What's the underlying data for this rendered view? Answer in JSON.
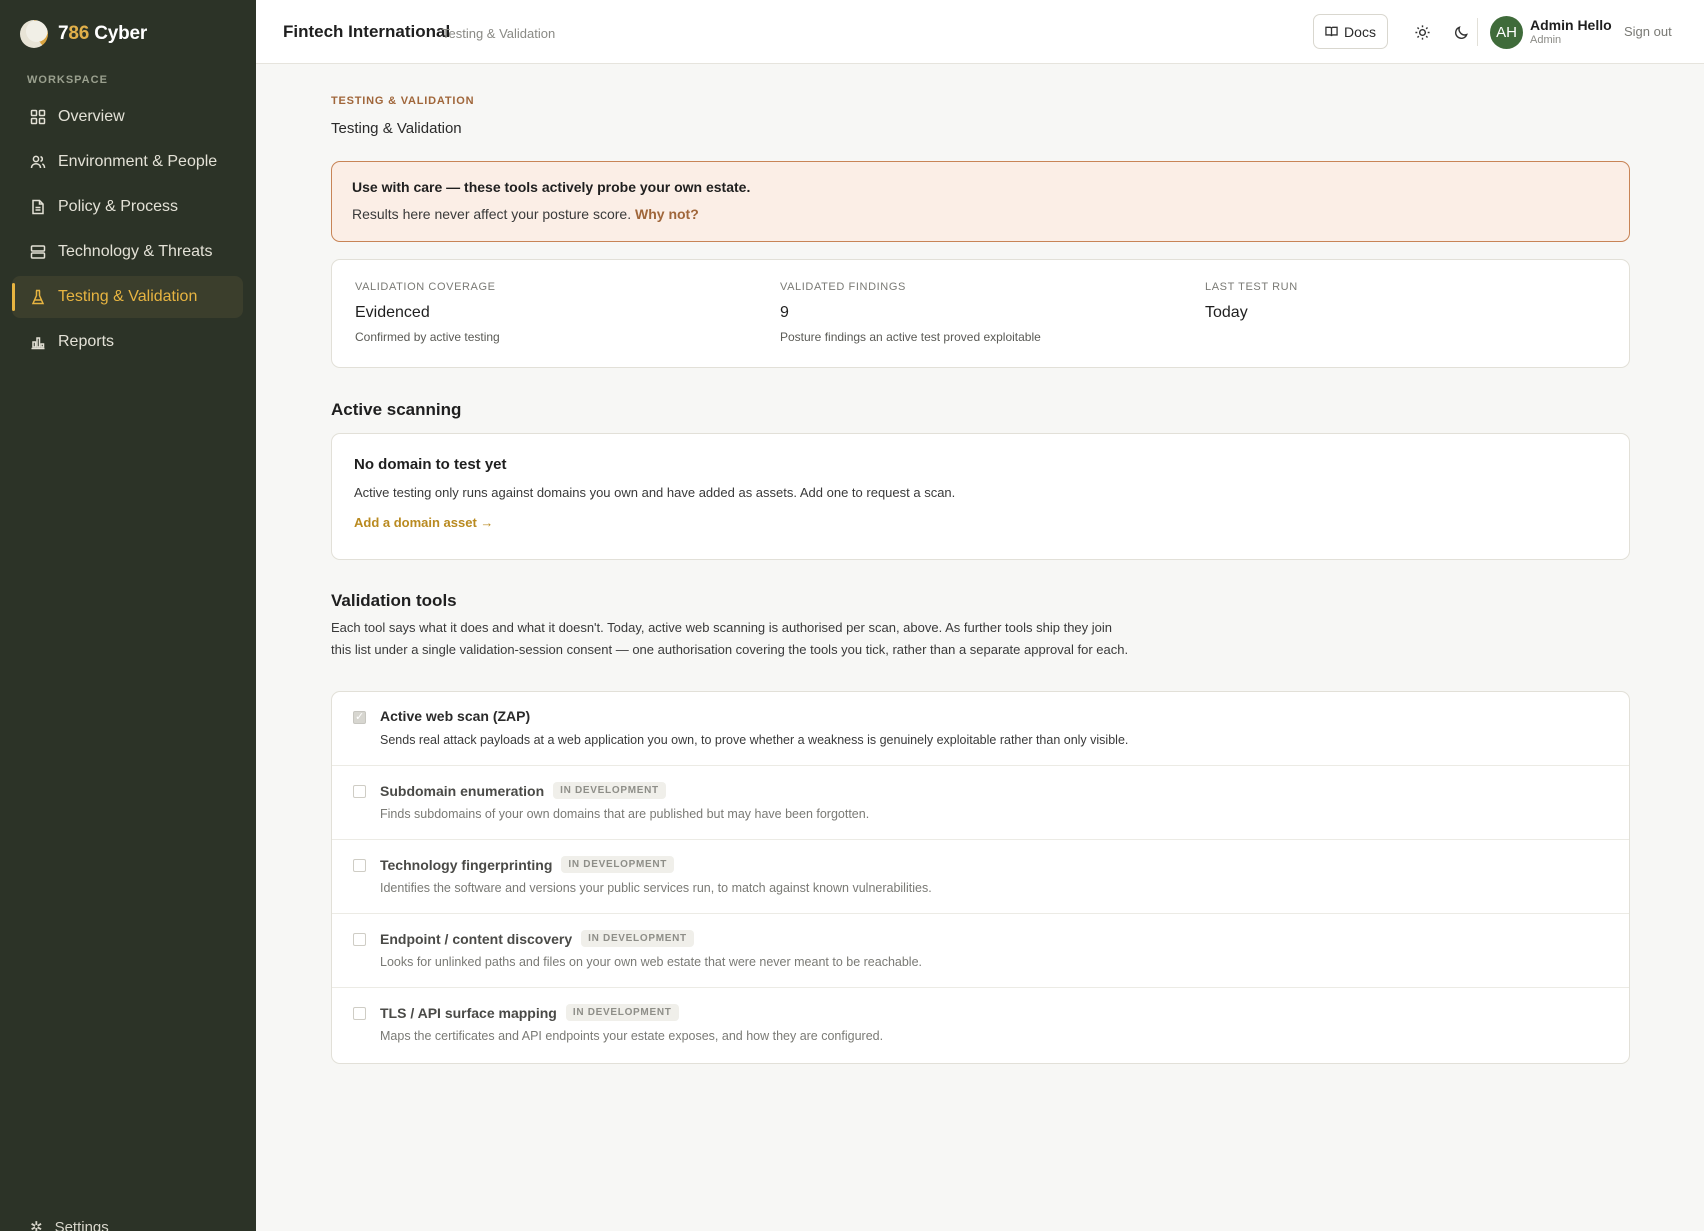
{
  "brand": {
    "name_prefix": "7",
    "name_accent": "86",
    "name_suffix": " Cyber"
  },
  "sidebar": {
    "section_label": "WORKSPACE",
    "items": [
      {
        "label": "Overview",
        "icon": "grid-icon",
        "active": false
      },
      {
        "label": "Environment & People",
        "icon": "users-icon",
        "active": false
      },
      {
        "label": "Policy & Process",
        "icon": "document-icon",
        "active": false
      },
      {
        "label": "Technology & Threats",
        "icon": "server-icon",
        "active": false
      },
      {
        "label": "Testing & Validation",
        "icon": "flask-icon",
        "active": true
      },
      {
        "label": "Reports",
        "icon": "bar-chart-icon",
        "active": false
      }
    ],
    "settings_label": "Settings"
  },
  "topbar": {
    "org_name": "Fintech International",
    "breadcrumb": "Testing & Validation",
    "docs_label": "Docs",
    "user_initials": "AH",
    "user_name": "Admin Hello",
    "user_role": "Admin",
    "signout_label": "Sign out"
  },
  "page": {
    "eyebrow": "TESTING & VALIDATION",
    "title": "Testing & Validation",
    "warning": {
      "title": "Use with care — these tools actively probe your own estate.",
      "body": "Results here never affect your posture score. ",
      "link": "Why not?"
    },
    "stats": [
      {
        "label": "VALIDATION COVERAGE",
        "value": "Evidenced",
        "note": "Confirmed by active testing"
      },
      {
        "label": "VALIDATED FINDINGS",
        "value": "9",
        "note": "Posture findings an active test proved exploitable"
      },
      {
        "label": "LAST TEST RUN",
        "value": "Today",
        "note": ""
      }
    ],
    "active_scanning": {
      "heading": "Active scanning",
      "card_title": "No domain to test yet",
      "card_body": "Active testing only runs against domains you own and have added as assets. Add one to request a scan.",
      "card_link": "Add a domain asset →"
    },
    "validation_tools": {
      "heading": "Validation tools",
      "intro": "Each tool says what it does and what it doesn't. Today, active web scanning is authorised per scan, above. As further tools ship they join this list under a single validation-session consent — one authorisation covering the tools you tick, rather than a separate approval for each.",
      "tools": [
        {
          "name": "Active web scan (ZAP)",
          "badge": "",
          "checked": true,
          "desc": "Sends real attack payloads at a web application you own, to prove whether a weakness is genuinely exploitable rather than only visible."
        },
        {
          "name": "Subdomain enumeration",
          "badge": "IN DEVELOPMENT",
          "checked": false,
          "desc": "Finds subdomains of your own domains that are published but may have been forgotten."
        },
        {
          "name": "Technology fingerprinting",
          "badge": "IN DEVELOPMENT",
          "checked": false,
          "desc": "Identifies the software and versions your public services run, to match against known vulnerabilities."
        },
        {
          "name": "Endpoint / content discovery",
          "badge": "IN DEVELOPMENT",
          "checked": false,
          "desc": "Looks for unlinked paths and files on your own web estate that were never meant to be reachable."
        },
        {
          "name": "TLS / API surface mapping",
          "badge": "IN DEVELOPMENT",
          "checked": false,
          "desc": "Maps the certificates and API endpoints your estate exposes, and how they are configured."
        }
      ]
    }
  }
}
